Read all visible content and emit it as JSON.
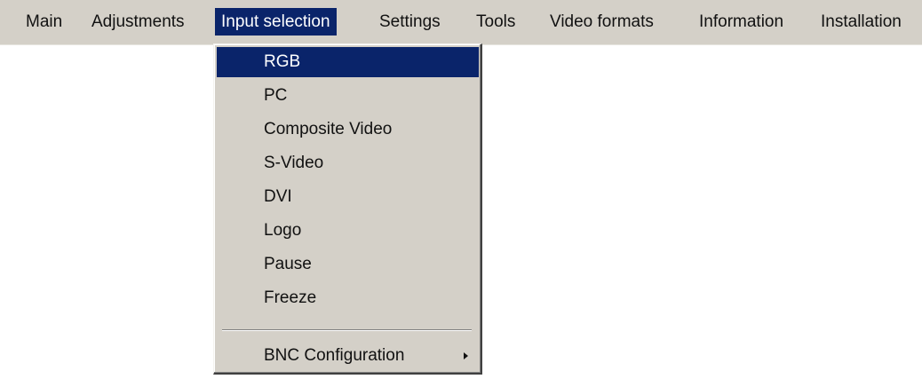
{
  "menubar": {
    "items": [
      {
        "label": "Main"
      },
      {
        "label": "Adjustments"
      },
      {
        "label": "Input selection"
      },
      {
        "label": "Settings"
      },
      {
        "label": "Tools"
      },
      {
        "label": "Video formats"
      },
      {
        "label": "Information"
      },
      {
        "label": "Installation"
      }
    ],
    "active_item": "Input selection"
  },
  "dropdown": {
    "items": [
      {
        "label": "RGB",
        "highlighted": true
      },
      {
        "label": "PC"
      },
      {
        "label": "Composite Video"
      },
      {
        "label": "S-Video"
      },
      {
        "label": "DVI"
      },
      {
        "label": "Logo"
      },
      {
        "label": "Pause"
      },
      {
        "label": "Freeze"
      }
    ],
    "submenu_item": {
      "label": "BNC Configuration",
      "icon": "submenu-arrow-icon"
    }
  },
  "colors": {
    "menu_background": "#d4d0c8",
    "highlight_background": "#0a246a",
    "highlight_text": "#ffffff",
    "text": "#111111"
  }
}
